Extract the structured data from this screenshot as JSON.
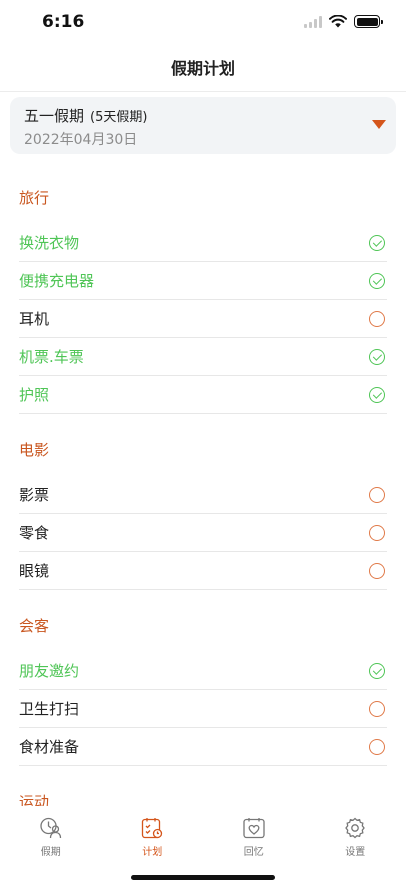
{
  "status_bar": {
    "time": "6:16"
  },
  "nav": {
    "title": "假期计划"
  },
  "holiday": {
    "name": "五一假期",
    "days": "(5天假期)",
    "date": "2022年04月30日"
  },
  "sections": [
    {
      "title": "旅行",
      "items": [
        {
          "label": "换洗衣物",
          "done": true
        },
        {
          "label": "便携充电器",
          "done": true
        },
        {
          "label": "耳机",
          "done": false
        },
        {
          "label": "机票.车票",
          "done": true
        },
        {
          "label": "护照",
          "done": true
        }
      ]
    },
    {
      "title": "电影",
      "items": [
        {
          "label": "影票",
          "done": false
        },
        {
          "label": "零食",
          "done": false
        },
        {
          "label": "眼镜",
          "done": false
        }
      ]
    },
    {
      "title": "会客",
      "items": [
        {
          "label": "朋友邀约",
          "done": true
        },
        {
          "label": "卫生打扫",
          "done": false
        },
        {
          "label": "食材准备",
          "done": false
        }
      ]
    },
    {
      "title": "运动",
      "items": []
    }
  ],
  "tabs": [
    {
      "label": "假期",
      "icon": "vacation-icon",
      "active": false
    },
    {
      "label": "计划",
      "icon": "plan-icon",
      "active": true
    },
    {
      "label": "回忆",
      "icon": "memory-icon",
      "active": false
    },
    {
      "label": "设置",
      "icon": "settings-icon",
      "active": false
    }
  ],
  "colors": {
    "accent": "#d4551b",
    "done_green": "#4fc556",
    "card_bg": "#f2f4f6"
  }
}
